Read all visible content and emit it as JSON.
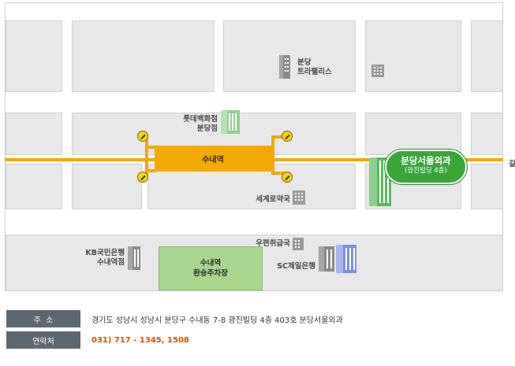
{
  "map": {
    "landmarks": {
      "bundang_terraplace": "분당\n트라팰리스",
      "lotte_dept": "롯데백화점\n분당점",
      "segye_pharmacy": "세계로약국",
      "post_office": "우편취급국",
      "sc_bank": "SC제일은행",
      "kb_bank": "KB국민은행\n수내역점",
      "edge_text": "길"
    },
    "station": "수내역",
    "hospital": {
      "name": "분당서울외과",
      "sub": "(광진빌딩 4층)"
    },
    "parking": "수내역\n환승주차장"
  },
  "info": {
    "address_label": "주  소",
    "address": "경기도 성남시 성남시 분당구 수내동 7-8 광진빌딩 4층 403호 분당서울외과",
    "contact_label": "연락처",
    "contact": "031) 717 - 1345, 1508"
  },
  "colors": {
    "road": "#f2a900",
    "hospital": "#3aa63a",
    "parking": "#a8d68e",
    "tag": "#5d6770",
    "phone": "#d45500"
  },
  "icons": [
    "building-icon",
    "subway-exit-icon"
  ]
}
